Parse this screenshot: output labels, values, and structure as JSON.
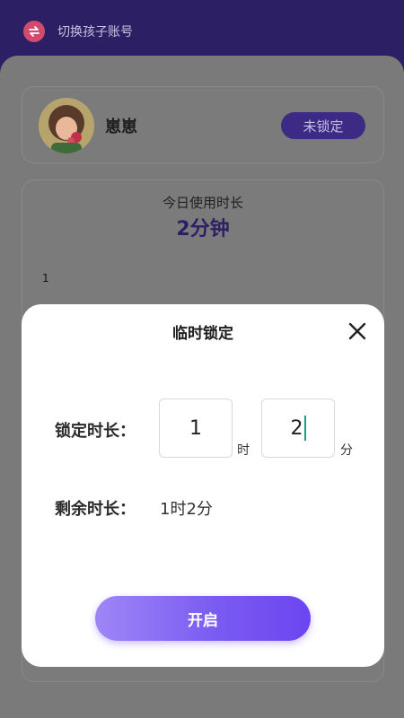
{
  "topbar": {
    "switch_label": "切换孩子账号",
    "icon": "switch-arrows-icon"
  },
  "child": {
    "name": "崽崽",
    "lock_status": "未锁定"
  },
  "usage": {
    "title": "今日使用时长",
    "value": "2分钟",
    "axis_tick": "1"
  },
  "modal": {
    "title": "临时锁定",
    "lock_duration_label": "锁定时长：",
    "hours_value": "1",
    "hours_unit": "时",
    "minutes_value": "2",
    "minutes_unit": "分",
    "remaining_label": "剩余时长：",
    "remaining_value": "1时2分",
    "start_button": "开启"
  },
  "colors": {
    "accent": "#6b45f0",
    "header": "#2d1f63",
    "caret": "#1aa08a"
  }
}
